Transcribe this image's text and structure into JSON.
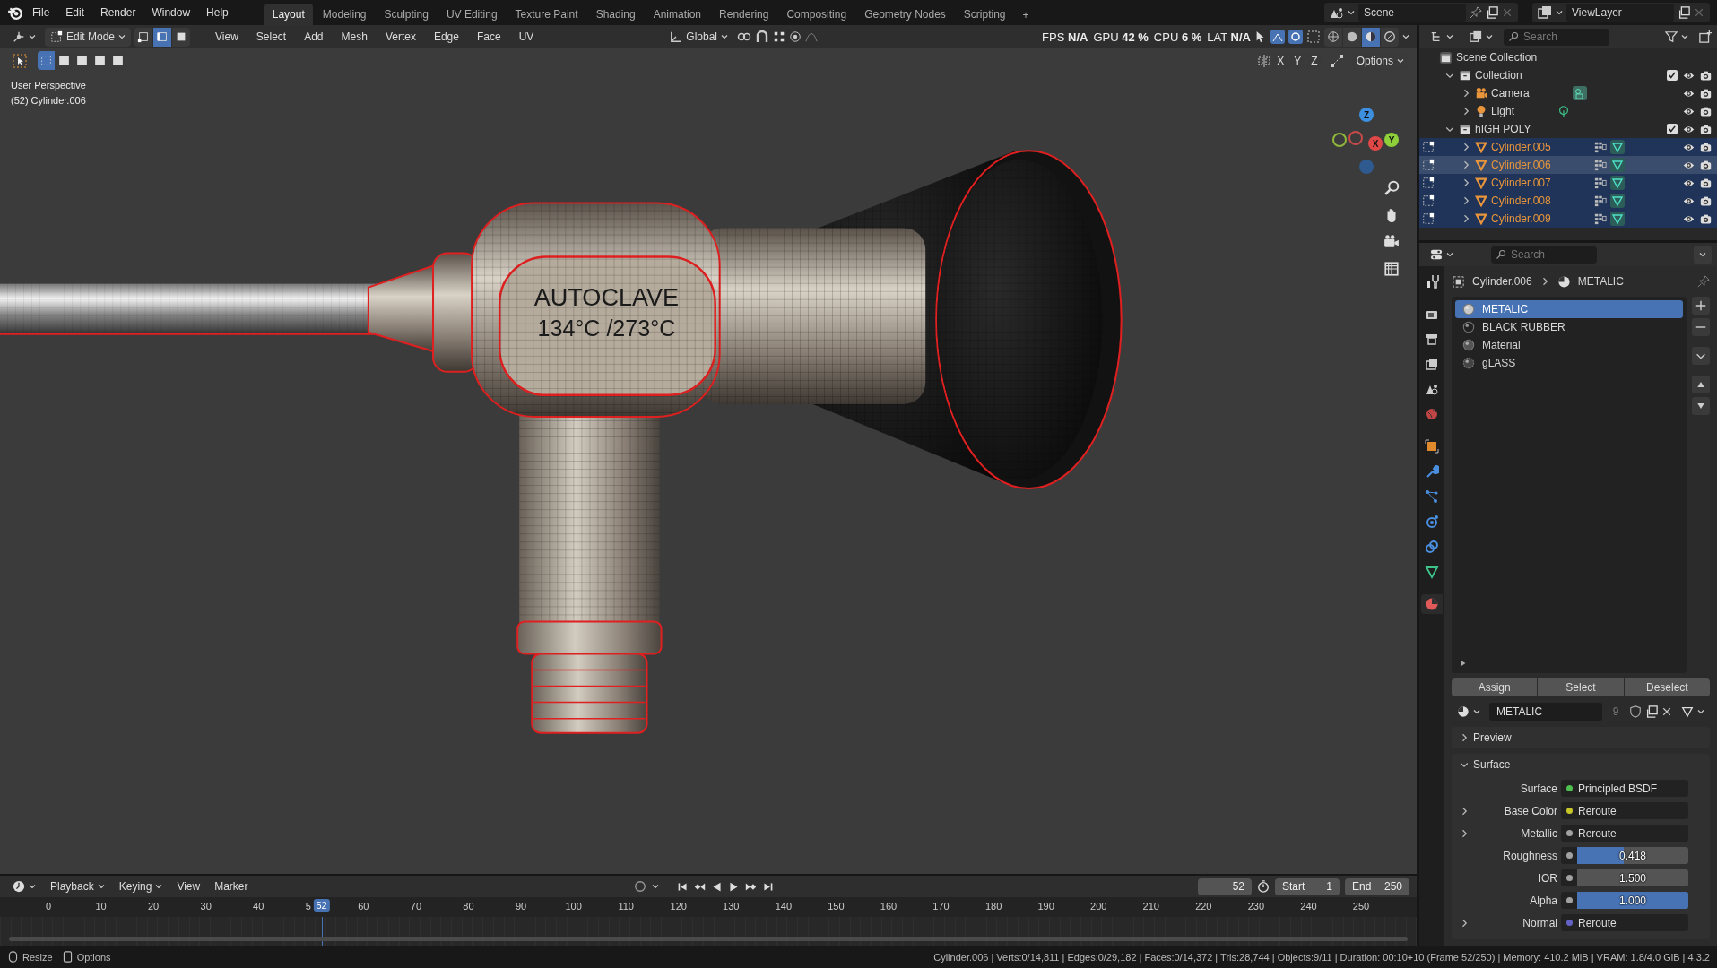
{
  "topbar": {
    "menus": [
      "File",
      "Edit",
      "Render",
      "Window",
      "Help"
    ],
    "workspaces": [
      {
        "label": "Layout",
        "selected": true
      },
      {
        "label": "Modeling",
        "selected": false
      },
      {
        "label": "Sculpting",
        "selected": false
      },
      {
        "label": "UV Editing",
        "selected": false
      },
      {
        "label": "Texture Paint",
        "selected": false
      },
      {
        "label": "Shading",
        "selected": false
      },
      {
        "label": "Animation",
        "selected": false
      },
      {
        "label": "Rendering",
        "selected": false
      },
      {
        "label": "Compositing",
        "selected": false
      },
      {
        "label": "Geometry Nodes",
        "selected": false
      },
      {
        "label": "Scripting",
        "selected": false
      }
    ],
    "add_tab": "+",
    "scene": "Scene",
    "view_layer": "ViewLayer"
  },
  "viewport": {
    "header": {
      "mode": "Edit Mode",
      "select_modes": [
        {
          "kind": "vertex",
          "selected": false
        },
        {
          "kind": "edge",
          "selected": true
        },
        {
          "kind": "face",
          "selected": false
        }
      ],
      "menus": [
        "View",
        "Select",
        "Add",
        "Mesh",
        "Vertex",
        "Edge",
        "Face",
        "UV"
      ],
      "orientation": "Global",
      "stats": [
        {
          "label": "FPS",
          "value": "N/A"
        },
        {
          "label": "GPU",
          "value": "42 %"
        },
        {
          "label": "CPU",
          "value": "6 %"
        },
        {
          "label": "LAT",
          "value": "N/A"
        }
      ],
      "shading_modes": [
        {
          "kind": "wireframe",
          "selected": false
        },
        {
          "kind": "solid",
          "selected": false
        },
        {
          "kind": "material",
          "selected": true
        },
        {
          "kind": "rendered",
          "selected": false
        }
      ]
    },
    "mirror_axes": [
      "X",
      "Y",
      "Z"
    ],
    "options": "Options",
    "view_name": "User Perspective",
    "object_info": "(52) Cylinder.006",
    "gizmo": {
      "z": "Z",
      "x": "X",
      "y": "Y"
    },
    "model_label": [
      "AUTOCLAVE",
      "134°C /273°C"
    ]
  },
  "outliner": {
    "search_placeholder": "Search",
    "root": "Scene Collection",
    "children": [
      {
        "name": "Collection",
        "kind": "collection",
        "expanded": true,
        "checked": true,
        "selected": false,
        "active": false,
        "children": [
          {
            "name": "Camera",
            "kind": "camera",
            "expanded": false,
            "selected": false,
            "active": false
          },
          {
            "name": "Light",
            "kind": "light",
            "expanded": false,
            "selected": false,
            "active": false
          }
        ]
      },
      {
        "name": "hIGH POLY",
        "kind": "collection",
        "expanded": true,
        "checked": true,
        "selected": false,
        "active": false,
        "children": [
          {
            "name": "Cylinder.005",
            "kind": "mesh",
            "expanded": false,
            "selected": true,
            "active": false
          },
          {
            "name": "Cylinder.006",
            "kind": "mesh",
            "expanded": false,
            "selected": true,
            "active": true
          },
          {
            "name": "Cylinder.007",
            "kind": "mesh",
            "expanded": false,
            "selected": true,
            "active": false
          },
          {
            "name": "Cylinder.008",
            "kind": "mesh",
            "expanded": false,
            "selected": true,
            "active": false
          },
          {
            "name": "Cylinder.009",
            "kind": "mesh",
            "expanded": false,
            "selected": true,
            "active": false
          }
        ]
      }
    ]
  },
  "properties": {
    "search_placeholder": "Search",
    "breadcrumb": [
      "Cylinder.006",
      "METALIC"
    ],
    "tabs": [
      {
        "kind": "tool",
        "selected": false
      },
      {
        "kind": "render",
        "selected": false
      },
      {
        "kind": "output",
        "selected": false
      },
      {
        "kind": "view_layer",
        "selected": false
      },
      {
        "kind": "scene",
        "selected": false
      },
      {
        "kind": "world",
        "selected": false
      },
      {
        "kind": "object",
        "selected": false
      },
      {
        "kind": "modifiers",
        "selected": false
      },
      {
        "kind": "particles",
        "selected": false
      },
      {
        "kind": "physics",
        "selected": false
      },
      {
        "kind": "constraints",
        "selected": false
      },
      {
        "kind": "data",
        "selected": false
      },
      {
        "kind": "material",
        "selected": true
      }
    ],
    "material_slots": [
      {
        "name": "METALIC",
        "kind": "metal",
        "selected": true
      },
      {
        "name": "BLACK RUBBER",
        "kind": "rubber",
        "selected": false
      },
      {
        "name": "Material",
        "kind": "plain",
        "selected": false
      },
      {
        "name": "gLASS",
        "kind": "glass",
        "selected": false
      }
    ],
    "slot_buttons": [
      "Assign",
      "Select",
      "Deselect"
    ],
    "material": {
      "name": "METALIC",
      "users": "9"
    },
    "panels": [
      {
        "title": "Preview",
        "expanded": false
      },
      {
        "title": "Surface",
        "expanded": true
      }
    ],
    "surface_rows": [
      {
        "label": "Surface",
        "kind": "link",
        "value": "Principled BSDF",
        "color": "#4ec04e",
        "expandable": false
      },
      {
        "label": "Base Color",
        "kind": "link",
        "value": "Reroute",
        "color": "#c7c729",
        "expandable": true
      },
      {
        "label": "Metallic",
        "kind": "link",
        "value": "Reroute",
        "color": "#a1a1a1",
        "expandable": true
      },
      {
        "label": "Roughness",
        "kind": "slider",
        "value": "0.418",
        "level": 0.418,
        "color": "#a1a1a1",
        "expandable": false
      },
      {
        "label": "IOR",
        "kind": "number",
        "value": "1.500",
        "color": "#a1a1a1",
        "expandable": false
      },
      {
        "label": "Alpha",
        "kind": "slider",
        "value": "1.000",
        "level": 1,
        "color": "#a1a1a1",
        "expandable": false
      },
      {
        "label": "Normal",
        "kind": "link",
        "value": "Reroute",
        "color": "#6363c7",
        "expandable": true
      }
    ]
  },
  "timeline": {
    "menus": [
      "Playback",
      "Keying",
      "View",
      "Marker"
    ],
    "current_frame": "52",
    "start_label": "Start",
    "start": "1",
    "end_label": "End",
    "end": "250",
    "ticks": [
      "0",
      "10",
      "20",
      "30",
      "40",
      "5",
      "60",
      "70",
      "80",
      "90",
      "100",
      "110",
      "120",
      "130",
      "140",
      "150",
      "160",
      "170",
      "180",
      "190",
      "200",
      "210",
      "220",
      "230",
      "240",
      "250"
    ],
    "playhead": "52"
  },
  "status_bar": {
    "left": [
      {
        "kind": "mouse",
        "label": "Resize"
      },
      {
        "kind": "options",
        "label": "Options"
      }
    ],
    "stats": "Cylinder.006 | Verts:0/14,811 | Edges:0/29,182 | Faces:0/14,372 | Tris:28,744 | Objects:9/11 | Duration: 00:10+10 (Frame 52/250) | Memory: 410.2 MiB | VRAM: 1.8/4.0 GiB | 4.3.2"
  }
}
